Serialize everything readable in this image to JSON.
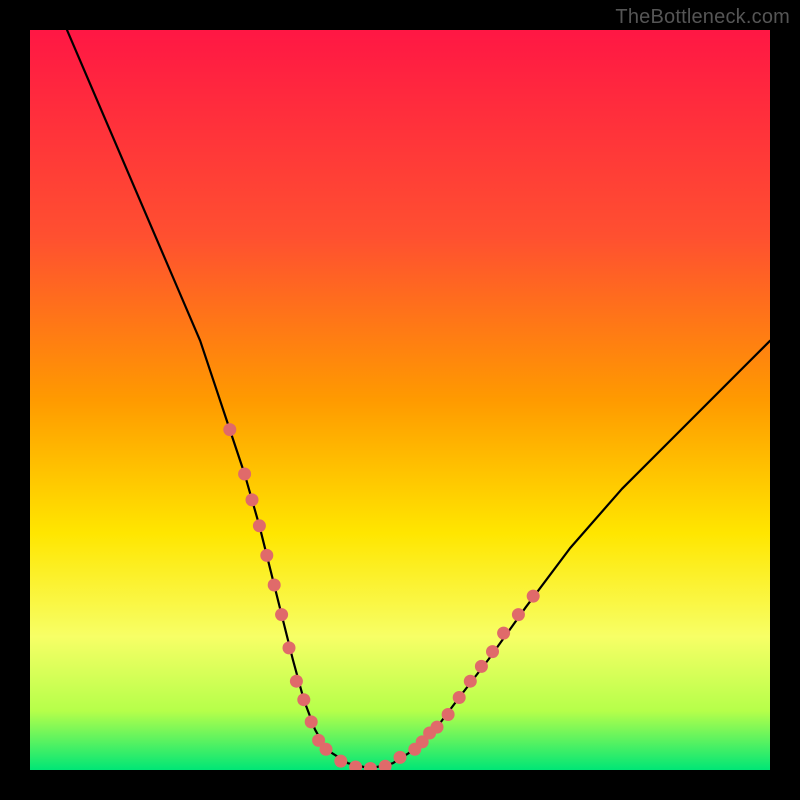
{
  "watermark": "TheBottleneck.com",
  "colors": {
    "frame": "#000000",
    "gradient_stops": [
      "#ff1744",
      "#ff8a00",
      "#ffe600",
      "#f7ff66",
      "#64ff3c",
      "#00e676"
    ],
    "curve": "#000000",
    "markers": "#e06a6a"
  },
  "chart_data": {
    "type": "line",
    "title": "",
    "xlabel": "",
    "ylabel": "",
    "xlim": [
      0,
      100
    ],
    "ylim": [
      0,
      100
    ],
    "series": [
      {
        "name": "bottleneck-curve",
        "x": [
          5,
          8,
          11,
          14,
          17,
          20,
          23,
          25,
          27,
          29,
          31,
          32.5,
          34,
          35.5,
          37,
          38.5,
          40,
          43,
          46,
          49,
          52,
          55,
          58,
          62,
          67,
          73,
          80,
          88,
          96,
          100
        ],
        "y": [
          100,
          93,
          86,
          79,
          72,
          65,
          58,
          52,
          46,
          40,
          33,
          27,
          21,
          15,
          9.5,
          5.5,
          2.8,
          0.9,
          0.2,
          0.9,
          2.8,
          5.8,
          9.8,
          15,
          22,
          30,
          38,
          46,
          54,
          58
        ]
      }
    ],
    "markers": {
      "name": "highlighted-points",
      "points": [
        [
          27,
          46
        ],
        [
          29,
          40
        ],
        [
          30,
          36.5
        ],
        [
          31,
          33
        ],
        [
          32,
          29
        ],
        [
          33,
          25
        ],
        [
          34,
          21
        ],
        [
          35,
          16.5
        ],
        [
          36,
          12
        ],
        [
          37,
          9.5
        ],
        [
          38,
          6.5
        ],
        [
          39,
          4
        ],
        [
          40,
          2.8
        ],
        [
          42,
          1.2
        ],
        [
          44,
          0.4
        ],
        [
          46,
          0.2
        ],
        [
          48,
          0.5
        ],
        [
          50,
          1.7
        ],
        [
          52,
          2.8
        ],
        [
          53,
          3.8
        ],
        [
          54,
          5
        ],
        [
          55,
          5.8
        ],
        [
          56.5,
          7.5
        ],
        [
          58,
          9.8
        ],
        [
          59.5,
          12
        ],
        [
          61,
          14
        ],
        [
          62.5,
          16
        ],
        [
          64,
          18.5
        ],
        [
          66,
          21
        ],
        [
          68,
          23.5
        ]
      ]
    }
  }
}
